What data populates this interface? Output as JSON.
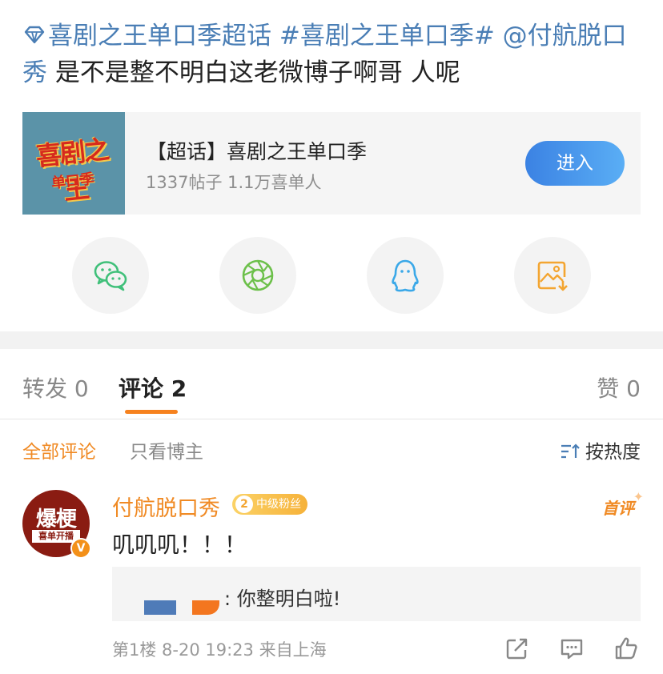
{
  "post": {
    "topic_label": "喜剧之王单口季超话",
    "hashtag": "#喜剧之王单口季#",
    "mention": "@付航脱口秀",
    "text": " 是不是整不明白这老微博子啊哥 人呢"
  },
  "chaohua_card": {
    "thumb_title": "喜剧之王",
    "thumb_sub": "单口季",
    "name": "【超话】喜剧之王单口季",
    "stats": "1337帖子 1.1万喜单人",
    "enter_label": "进入"
  },
  "share": {
    "icons": [
      "wechat-icon",
      "moments-icon",
      "qq-icon",
      "save-image-icon"
    ]
  },
  "tabs": {
    "repost_label": "转发",
    "repost_count": "0",
    "comment_label": "评论",
    "comment_count": "2",
    "like_label": "赞",
    "like_count": "0"
  },
  "filters": {
    "all": "全部评论",
    "blogger_only": "只看博主",
    "sort": "按热度"
  },
  "comment": {
    "avatar_main": "爆梗",
    "avatar_sub": "喜单开播",
    "verified": "V",
    "author": "付航脱口秀",
    "fan_level": "2",
    "fan_badge": "中级粉丝",
    "first_badge": "首评",
    "text": "叽叽叽！！！",
    "reply_text": ": 你整明白啦!",
    "meta": "第1楼 8-20 19:23 来自上海"
  },
  "colors": {
    "link": "#4a7eb5",
    "accent_orange": "#f08a24",
    "enter_button": "#4a98ec"
  }
}
